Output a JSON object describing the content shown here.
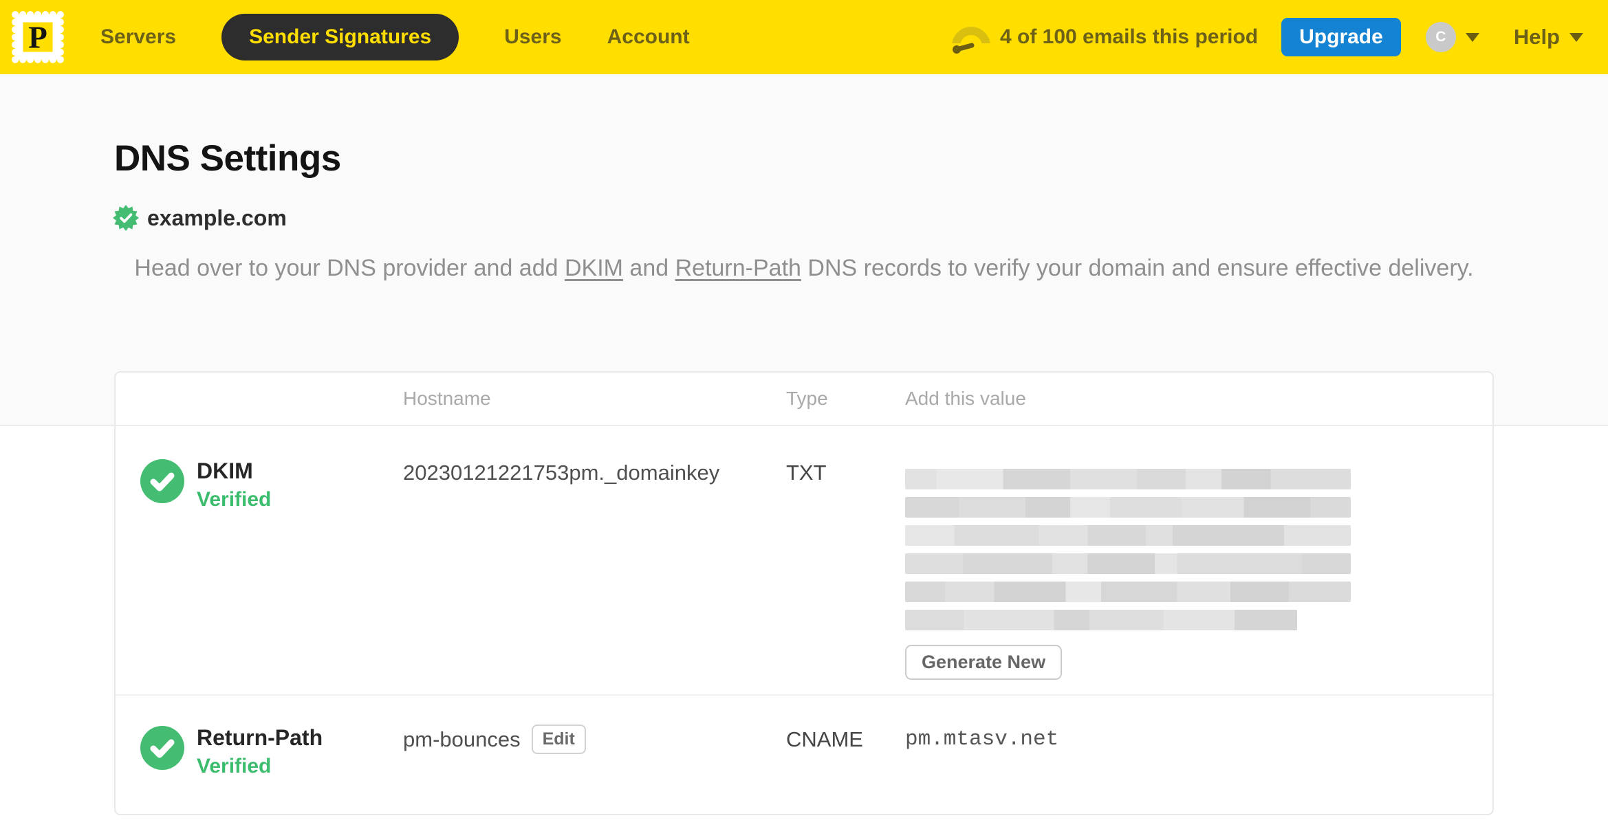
{
  "topbar": {
    "logo_letter": "P",
    "nav": [
      {
        "label": "Servers",
        "active": false
      },
      {
        "label": "Sender Signatures",
        "active": true
      },
      {
        "label": "Users",
        "active": false
      },
      {
        "label": "Account",
        "active": false
      }
    ],
    "usage_text": "4 of 100 emails this period",
    "upgrade_label": "Upgrade",
    "avatar_letter": "C",
    "help_label": "Help"
  },
  "page": {
    "title": "DNS Settings",
    "domain": "example.com",
    "intro": {
      "part1": "Head over to your DNS provider and add ",
      "link1": "DKIM",
      "part2": " and ",
      "link2": "Return-Path",
      "part3": " DNS records to verify your domain and ensure effective delivery."
    }
  },
  "table": {
    "headers": {
      "hostname": "Hostname",
      "type": "Type",
      "value": "Add this value"
    },
    "rows": [
      {
        "name": "DKIM",
        "status": "Verified",
        "hostname": "20230121221753pm._domainkey",
        "type": "TXT",
        "value_redacted": true,
        "action_label": "Generate New"
      },
      {
        "name": "Return-Path",
        "status": "Verified",
        "hostname": "pm-bounces",
        "edit_label": "Edit",
        "type": "CNAME",
        "value": "pm.mtasv.net"
      }
    ]
  },
  "colors": {
    "brand_yellow": "#FFDE00",
    "nav_text": "#6d6118",
    "active_pill_bg": "#2d2d2d",
    "upgrade_blue": "#1583d3",
    "verified_green": "#3cbd6e",
    "badge_green": "#44bd72",
    "page_bg": "#fafafa"
  }
}
